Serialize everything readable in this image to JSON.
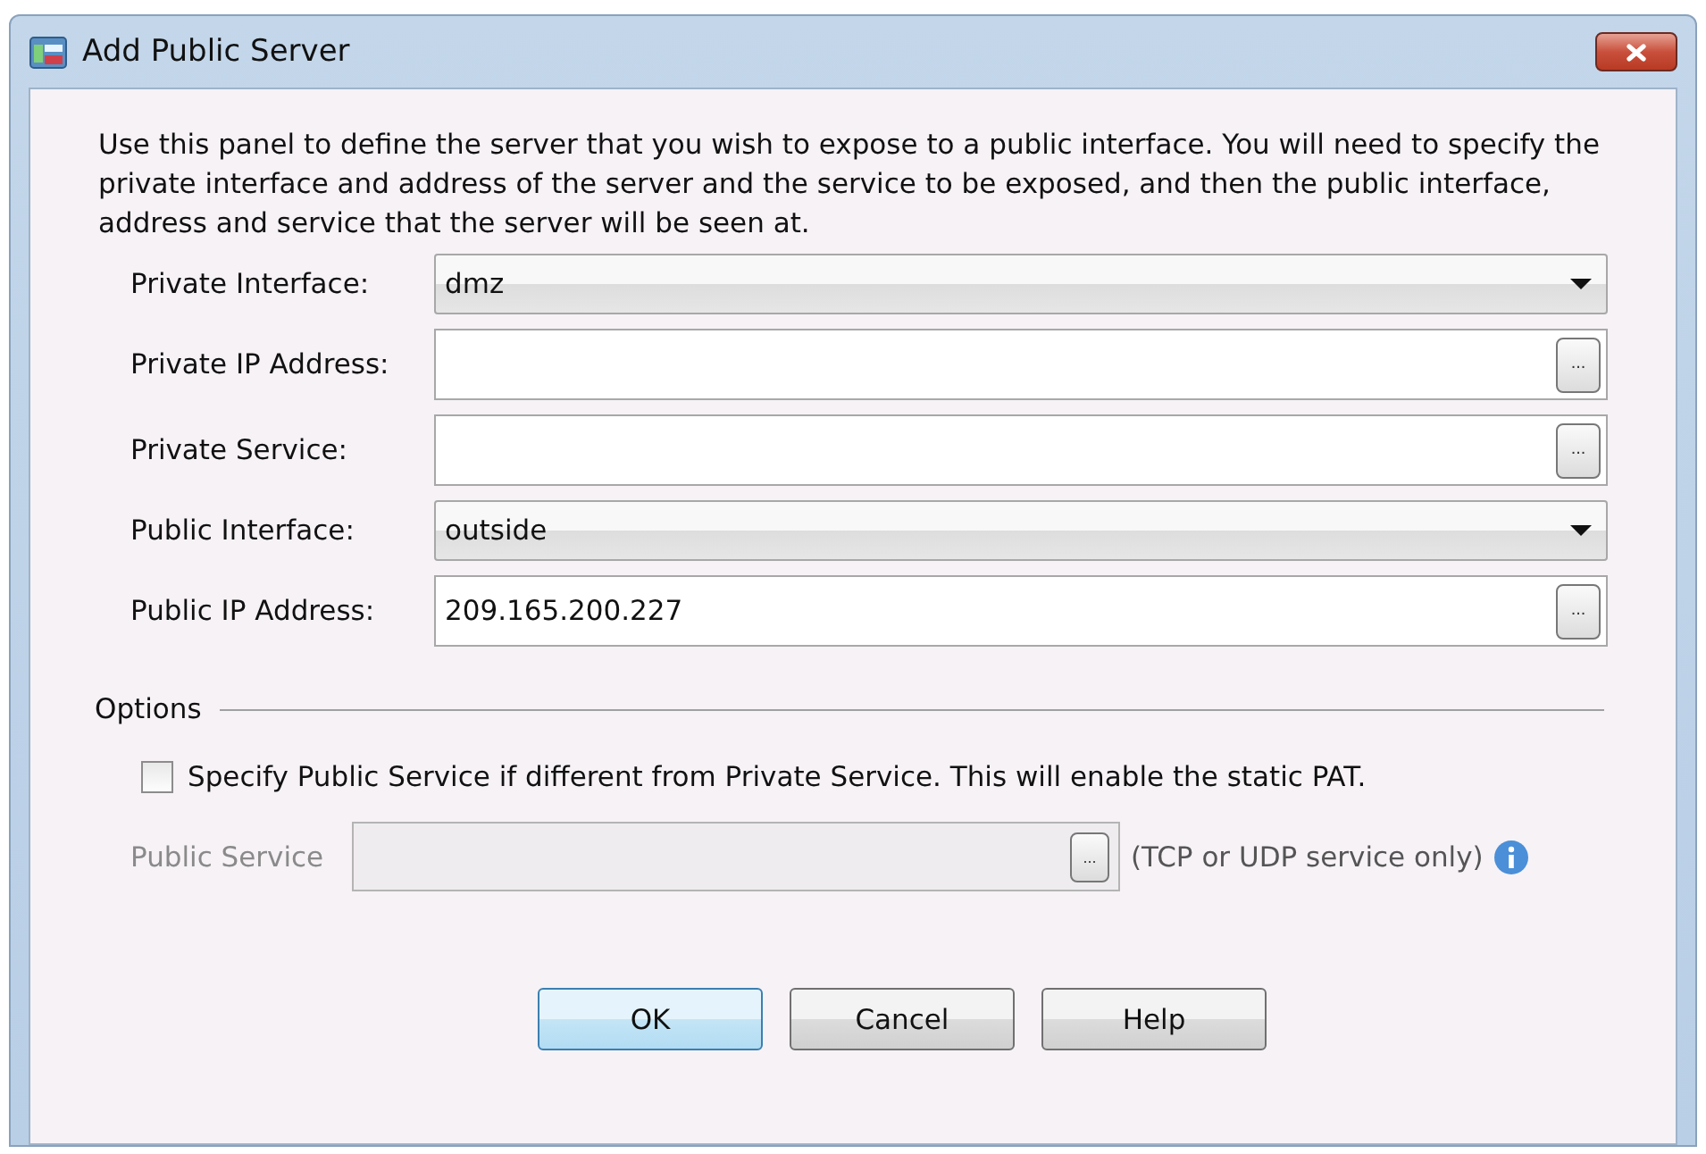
{
  "window": {
    "title": "Add Public Server"
  },
  "description": "Use this panel to define the server that you wish to expose to a public interface. You will need to specify the private interface and address of the server and the service to be exposed, and then the public interface, address and service that the server will be seen at.",
  "fields": [
    {
      "label": "Private Interface:",
      "kind": "dropdown",
      "value": "dmz"
    },
    {
      "label": "Private IP Address:",
      "kind": "browse",
      "button": "..."
    },
    {
      "label": "Private Service:",
      "kind": "browse",
      "button": "..."
    },
    {
      "label": "Public Interface:",
      "kind": "dropdown",
      "value": "outside"
    },
    {
      "label": "Public IP Address:",
      "kind": "browse",
      "value": "209.165.200.227",
      "button": "..."
    }
  ],
  "options": {
    "title": "Options",
    "checkbox": {
      "label": "Specify Public Service if different from Private Service.  This will enable the static PAT.",
      "checked": false
    },
    "public_service": {
      "label": "Public Service",
      "disabled": true,
      "button": "...",
      "hint": "(TCP or UDP service only)"
    }
  },
  "buttons": [
    {
      "label": "OK",
      "default": true
    },
    {
      "label": "Cancel",
      "default": false
    },
    {
      "label": "Help",
      "default": false
    }
  ]
}
